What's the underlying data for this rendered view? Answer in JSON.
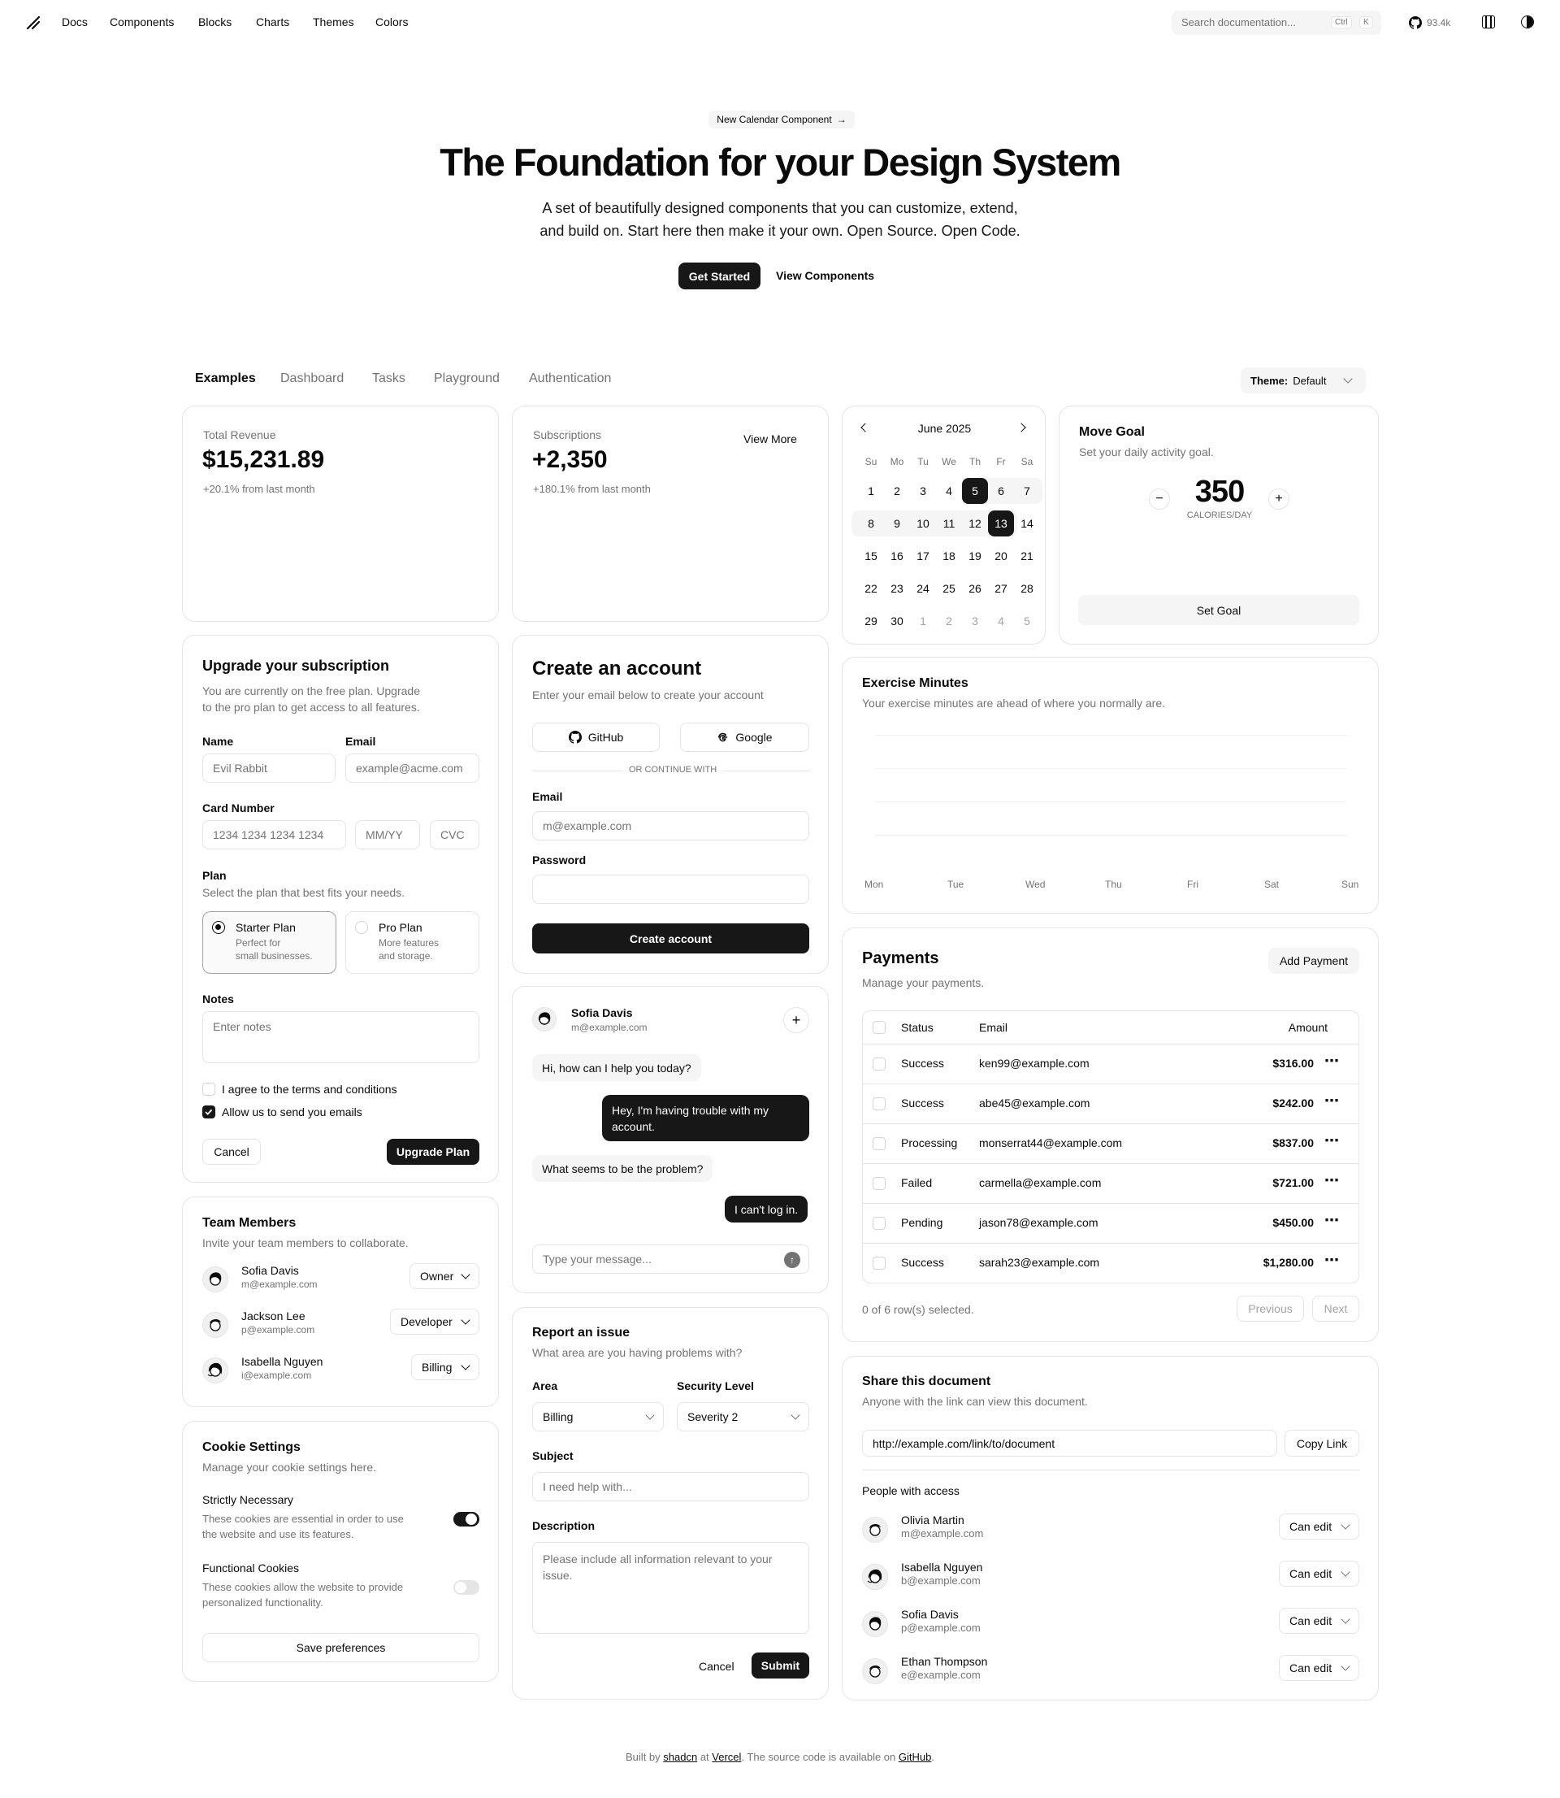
{
  "nav": {
    "items": [
      "Docs",
      "Components",
      "Blocks",
      "Charts",
      "Themes",
      "Colors"
    ],
    "search_placeholder": "Search documentation...",
    "kbd1": "Ctrl",
    "kbd2": "K",
    "stars": "93.4k"
  },
  "hero": {
    "badge": "New Calendar Component",
    "title": "The Foundation for your Design System",
    "subtitle_1": "A set of beautifully designed components that you can customize, extend,",
    "subtitle_2": "and build on. Start here then make it your own. Open Source. Open Code.",
    "primary": "Get Started",
    "secondary": "View Components"
  },
  "tabs": {
    "items": [
      "Examples",
      "Dashboard",
      "Tasks",
      "Playground",
      "Authentication"
    ],
    "theme_label": "Theme:",
    "theme_value": "Default"
  },
  "revenue": {
    "label": "Total Revenue",
    "value": "$15,231.89",
    "change": "+20.1% from last month"
  },
  "subs": {
    "label": "Subscriptions",
    "value": "+2,350",
    "change": "+180.1% from last month",
    "link": "View More"
  },
  "calendar": {
    "month": "June 2025",
    "weekdays": [
      "Su",
      "Mo",
      "Tu",
      "We",
      "Th",
      "Fr",
      "Sa"
    ],
    "weeks": [
      [
        "1",
        "2",
        "3",
        "4",
        "5",
        "6",
        "7"
      ],
      [
        "8",
        "9",
        "10",
        "11",
        "12",
        "13",
        "14"
      ],
      [
        "15",
        "16",
        "17",
        "18",
        "19",
        "20",
        "21"
      ],
      [
        "22",
        "23",
        "24",
        "25",
        "26",
        "27",
        "28"
      ],
      [
        "29",
        "30",
        "1",
        "2",
        "3",
        "4",
        "5"
      ]
    ],
    "range_start": "5",
    "range_end": "13"
  },
  "goal": {
    "title": "Move Goal",
    "desc": "Set your daily activity goal.",
    "value": "350",
    "unit": "CALORIES/DAY",
    "button": "Set Goal"
  },
  "exercise": {
    "title": "Exercise Minutes",
    "desc": "Your exercise minutes are ahead of where you normally are.",
    "days": [
      "Mon",
      "Tue",
      "Wed",
      "Thu",
      "Fri",
      "Sat",
      "Sun"
    ]
  },
  "upgrade": {
    "title": "Upgrade your subscription",
    "desc_1": "You are currently on the free plan. Upgrade",
    "desc_2": "to the pro plan to get access to all features.",
    "name_label": "Name",
    "name_ph": "Evil Rabbit",
    "email_label": "Email",
    "email_ph": "example@acme.com",
    "card_label": "Card Number",
    "card_ph": "1234 1234 1234 1234",
    "exp_ph": "MM/YY",
    "cvc_ph": "CVC",
    "plan_label": "Plan",
    "plan_desc": "Select the plan that best fits your needs.",
    "starter": "Starter Plan",
    "starter_d1": "Perfect for",
    "starter_d2": "small businesses.",
    "pro": "Pro Plan",
    "pro_d1": "More features",
    "pro_d2": "and storage.",
    "notes_label": "Notes",
    "notes_ph": "Enter notes",
    "terms": "I agree to the terms and conditions",
    "emails": "Allow us to send you emails",
    "cancel": "Cancel",
    "submit": "Upgrade Plan"
  },
  "account": {
    "title": "Create an account",
    "desc": "Enter your email below to create your account",
    "github": "GitHub",
    "google": "Google",
    "divider": "OR CONTINUE WITH",
    "email_label": "Email",
    "email_ph": "m@example.com",
    "password_label": "Password",
    "submit": "Create account"
  },
  "chat": {
    "name": "Sofia Davis",
    "email": "m@example.com",
    "messages": [
      {
        "from": "agent",
        "text": "Hi, how can I help you today?"
      },
      {
        "from": "user",
        "text_1": "Hey, I'm having trouble with my",
        "text_2": "account."
      },
      {
        "from": "agent",
        "text": "What seems to be the problem?"
      },
      {
        "from": "user",
        "text": "I can't log in."
      }
    ],
    "input_ph": "Type your message..."
  },
  "payments": {
    "title": "Payments",
    "desc": "Manage your payments.",
    "add": "Add Payment",
    "headers": [
      "Status",
      "Email",
      "Amount"
    ],
    "rows": [
      [
        "Success",
        "ken99@example.com",
        "$316.00"
      ],
      [
        "Success",
        "abe45@example.com",
        "$242.00"
      ],
      [
        "Processing",
        "monserrat44@example.com",
        "$837.00"
      ],
      [
        "Failed",
        "carmella@example.com",
        "$721.00"
      ],
      [
        "Pending",
        "jason78@example.com",
        "$450.00"
      ],
      [
        "Success",
        "sarah23@example.com",
        "$1,280.00"
      ]
    ],
    "selected": "0 of 6 row(s) selected.",
    "prev": "Previous",
    "next": "Next"
  },
  "team": {
    "title": "Team Members",
    "desc": "Invite your team members to collaborate.",
    "members": [
      {
        "name": "Sofia Davis",
        "email": "m@example.com",
        "role": "Owner"
      },
      {
        "name": "Jackson Lee",
        "email": "p@example.com",
        "role": "Developer"
      },
      {
        "name": "Isabella Nguyen",
        "email": "i@example.com",
        "role": "Billing"
      }
    ]
  },
  "cookie": {
    "title": "Cookie Settings",
    "desc": "Manage your cookie settings here.",
    "strict_title": "Strictly Necessary",
    "strict_d1": "These cookies are essential in order to use",
    "strict_d2": "the website and use its features.",
    "func_title": "Functional Cookies",
    "func_d1": "These cookies allow the website to provide",
    "func_d2": "personalized functionality.",
    "save": "Save preferences"
  },
  "report": {
    "title": "Report an issue",
    "desc": "What area are you having problems with?",
    "area_label": "Area",
    "area_value": "Billing",
    "sec_label": "Security Level",
    "sec_value": "Severity 2",
    "subject_label": "Subject",
    "subject_ph": "I need help with...",
    "desc_label": "Description",
    "desc_ph_1": "Please include all information relevant to your",
    "desc_ph_2": "issue.",
    "cancel": "Cancel",
    "submit": "Submit"
  },
  "share": {
    "title": "Share this document",
    "desc": "Anyone with the link can view this document.",
    "link": "http://example.com/link/to/document",
    "copy": "Copy Link",
    "people_label": "People with access",
    "people": [
      {
        "name": "Olivia Martin",
        "email": "m@example.com",
        "perm": "Can edit"
      },
      {
        "name": "Isabella Nguyen",
        "email": "b@example.com",
        "perm": "Can edit"
      },
      {
        "name": "Sofia Davis",
        "email": "p@example.com",
        "perm": "Can edit"
      },
      {
        "name": "Ethan Thompson",
        "email": "e@example.com",
        "perm": "Can edit"
      }
    ]
  },
  "footer": {
    "t1": "Built by",
    "shadcn": "shadcn",
    "t2": "at",
    "vercel": "Vercel",
    "t3": ". The source code is available on",
    "github": "GitHub",
    "t4": "."
  }
}
